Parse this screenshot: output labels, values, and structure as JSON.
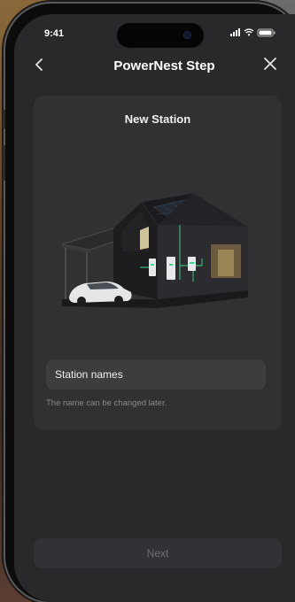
{
  "status_bar": {
    "time": "9:41"
  },
  "nav": {
    "title": "PowerNest Step",
    "back_icon": "chevron-left-icon",
    "close_icon": "close-icon"
  },
  "card": {
    "title": "New Station",
    "illustration": "house-with-solar-and-car",
    "name_input": {
      "placeholder": "Station names",
      "value": ""
    },
    "hint": "The name can be changed later."
  },
  "footer": {
    "next_label": "Next"
  },
  "colors": {
    "screen_bg": "#29292b",
    "card_bg": "#313134",
    "accent_green": "#39d98a"
  }
}
